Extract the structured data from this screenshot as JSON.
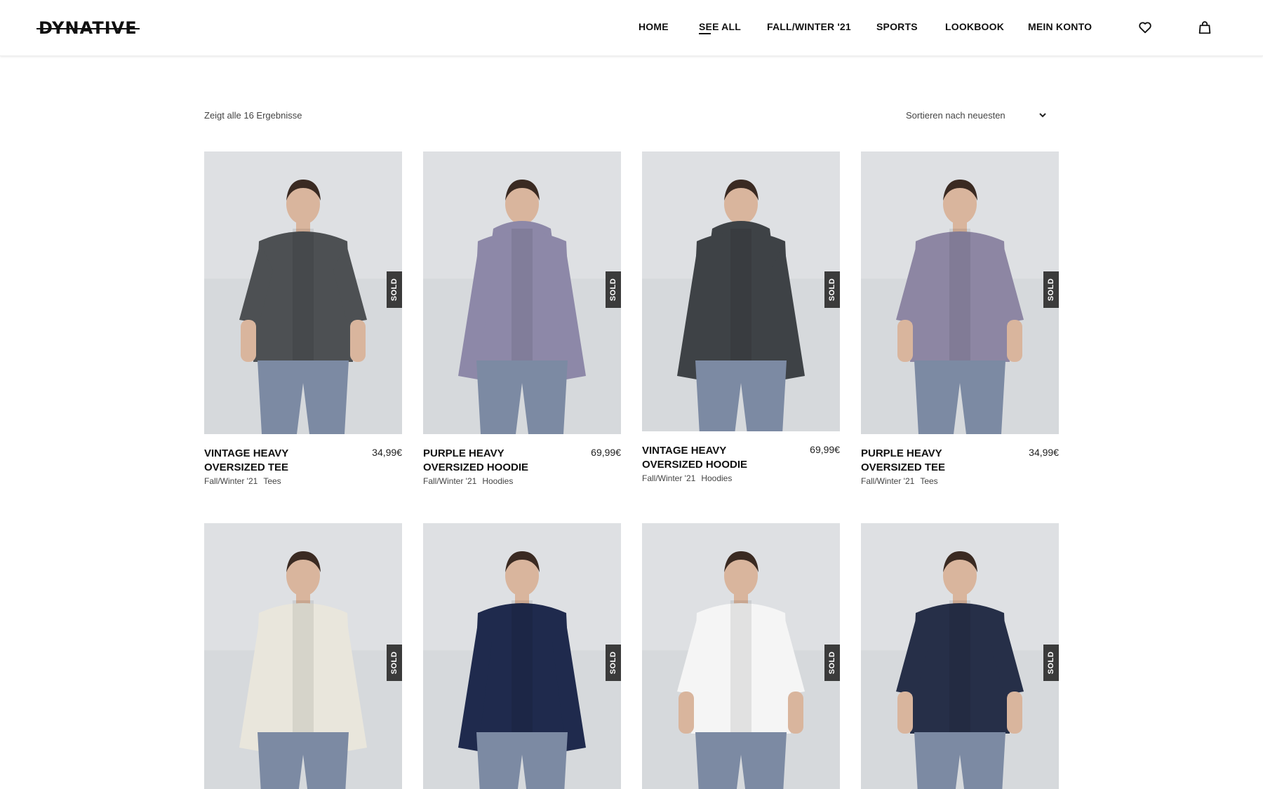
{
  "brand": {
    "logo_text": "DYNATIVE"
  },
  "nav": {
    "items": [
      {
        "label": "HOME"
      },
      {
        "label": "SEE ALL"
      },
      {
        "label": "FALL/WINTER '21"
      },
      {
        "label": "SPORTS"
      },
      {
        "label": "LOOKBOOK"
      },
      {
        "label": "MEIN KONTO"
      }
    ],
    "active": "SEE ALL",
    "icons": [
      "heart-icon",
      "shopping-bag-icon"
    ]
  },
  "listing": {
    "results_text": "Zeigt alle 16 Ergebnisse",
    "sort_label": "Sortieren nach neuesten"
  },
  "products": [
    {
      "name": "VINTAGE HEAVY OVERSIZED TEE",
      "price": "34,99€",
      "collection": "Fall/Winter '21",
      "category": "Tees",
      "badge": "SOLD",
      "garment": "t-shirt",
      "color": "#4d5053"
    },
    {
      "name": "PURPLE HEAVY OVERSIZED HOODIE",
      "price": "69,99€",
      "collection": "Fall/Winter '21",
      "category": "Hoodies",
      "badge": "SOLD",
      "garment": "hoodie",
      "color": "#8d88a8"
    },
    {
      "name": "VINTAGE HEAVY OVERSIZED HOODIE",
      "price": "69,99€",
      "collection": "Fall/Winter '21",
      "category": "Hoodies",
      "badge": "SOLD",
      "garment": "hoodie",
      "color": "#3e4246"
    },
    {
      "name": "PURPLE HEAVY OVERSIZED TEE",
      "price": "34,99€",
      "collection": "Fall/Winter '21",
      "category": "Tees",
      "badge": "SOLD",
      "garment": "t-shirt",
      "color": "#8d86a3"
    },
    {
      "name": "",
      "price": "",
      "collection": "",
      "category": "",
      "badge": "SOLD",
      "garment": "sweater",
      "color": "#e9e6dc"
    },
    {
      "name": "",
      "price": "",
      "collection": "",
      "category": "",
      "badge": "SOLD",
      "garment": "sweater",
      "color": "#1f2a4d"
    },
    {
      "name": "",
      "price": "",
      "collection": "",
      "category": "",
      "badge": "SOLD",
      "garment": "t-shirt",
      "color": "#f5f5f5"
    },
    {
      "name": "",
      "price": "",
      "collection": "",
      "category": "",
      "badge": "SOLD",
      "garment": "t-shirt",
      "color": "#262f48"
    }
  ],
  "colors": {
    "header_bg": "#ffffff",
    "text": "#111111",
    "badge_bg": "#3b3b3b",
    "photo_bg": "#d6d9dc"
  }
}
